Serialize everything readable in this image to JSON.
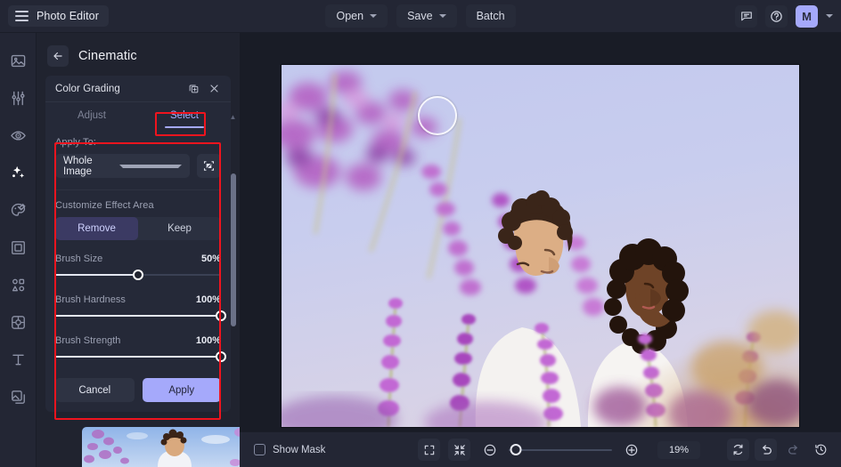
{
  "app": {
    "brand": "Photo Editor",
    "menu_icon": "hamburger-icon"
  },
  "topbar": {
    "open_label": "Open",
    "save_label": "Save",
    "batch_label": "Batch",
    "feedback_icon": "chat-icon",
    "help_icon": "question-mark-icon",
    "avatar_initial": "M",
    "avatar_color": "#a5a9fb"
  },
  "rail": {
    "items": [
      {
        "icon": "image-icon",
        "name": "sidebar-item-image",
        "active": false
      },
      {
        "icon": "sliders-icon",
        "name": "sidebar-item-adjust",
        "active": false
      },
      {
        "icon": "eye-icon",
        "name": "sidebar-item-retouch",
        "active": false
      },
      {
        "icon": "sparkles-icon",
        "name": "sidebar-item-effects",
        "active": true
      },
      {
        "icon": "palette-icon",
        "name": "sidebar-item-color",
        "active": false
      },
      {
        "icon": "frame-icon",
        "name": "sidebar-item-frame",
        "active": false
      },
      {
        "icon": "shapes-icon",
        "name": "sidebar-item-shapes",
        "active": false
      },
      {
        "icon": "focus-icon",
        "name": "sidebar-item-focus",
        "active": false
      },
      {
        "icon": "text-icon",
        "name": "sidebar-item-text",
        "active": false
      },
      {
        "icon": "layers-icon",
        "name": "sidebar-item-layers",
        "active": false
      }
    ]
  },
  "panel": {
    "back_icon": "arrow-left-icon",
    "title": "Cinematic",
    "card": {
      "title": "Color Grading",
      "duplicate_icon": "copy-icon",
      "close_icon": "close-icon",
      "tabs": [
        {
          "label": "Adjust",
          "active": false
        },
        {
          "label": "Select",
          "active": true
        }
      ],
      "apply_to_label": "Apply To:",
      "apply_to_value": "Whole Image",
      "apply_to_options": [
        "Whole Image"
      ],
      "mask_icon": "mask-select-icon",
      "customize_label": "Customize Effect Area",
      "mode_options": [
        {
          "label": "Remove",
          "active": true
        },
        {
          "label": "Keep",
          "active": false
        }
      ],
      "sliders": [
        {
          "name": "Brush Size",
          "value": "50%",
          "percent": 50
        },
        {
          "name": "Brush Hardness",
          "value": "100%",
          "percent": 100
        },
        {
          "name": "Brush Strength",
          "value": "100%",
          "percent": 100
        }
      ],
      "cancel_label": "Cancel",
      "apply_label": "Apply"
    }
  },
  "bottombar": {
    "show_mask_label": "Show Mask",
    "show_mask_checked": false,
    "fit_icon": "fit-screen-icon",
    "shrink_icon": "collapse-icon",
    "zoom_out_icon": "zoom-out-icon",
    "zoom_in_icon": "zoom-in-icon",
    "zoom_value": "19%",
    "zoom_percent": 19,
    "reset_icon": "reset-icon",
    "undo_icon": "undo-icon",
    "redo_icon": "redo-icon",
    "history_icon": "history-icon"
  },
  "annotations": {
    "color": "#f0141e",
    "boxes": [
      "select-tab-highlight",
      "select-panel-body-highlight"
    ]
  }
}
